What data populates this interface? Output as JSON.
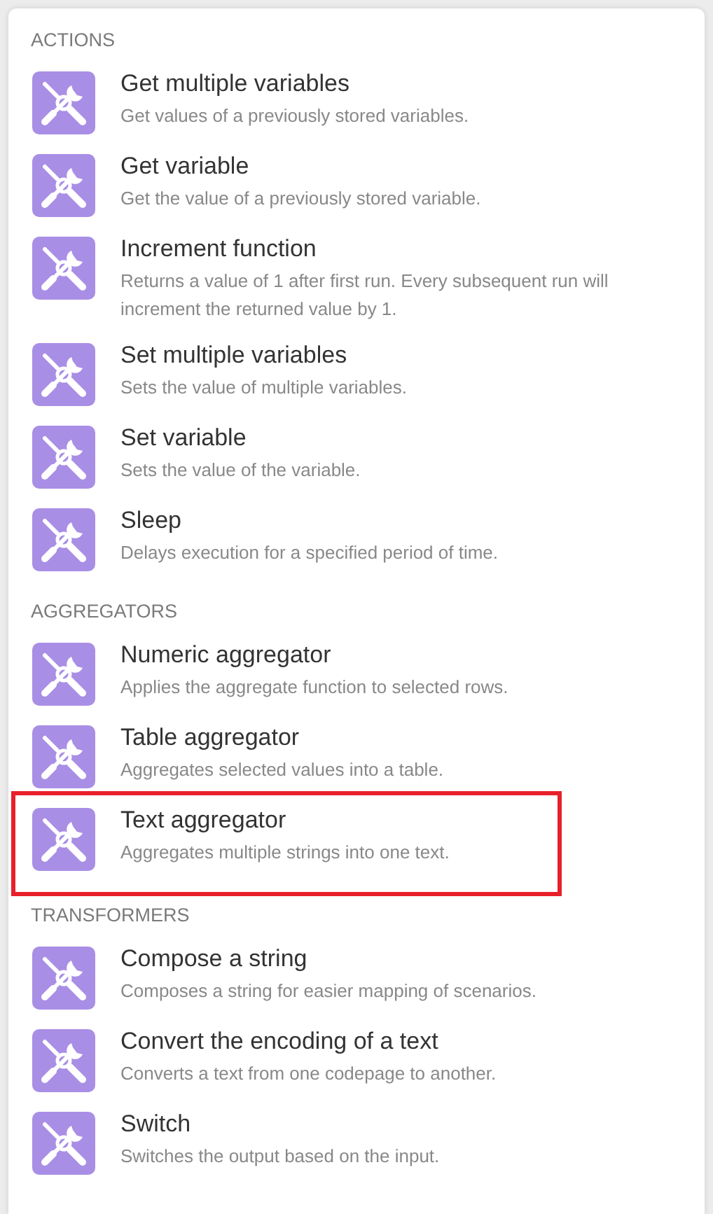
{
  "sections": [
    {
      "heading": "ACTIONS",
      "items": [
        {
          "title": "Get multiple variables",
          "description": "Get values of a previously stored variables.",
          "highlighted": false
        },
        {
          "title": "Get variable",
          "description": "Get the value of a previously stored variable.",
          "highlighted": false
        },
        {
          "title": "Increment function",
          "description": "Returns a value of 1 after first run. Every subsequent run will increment the returned value by 1.",
          "highlighted": false
        },
        {
          "title": "Set multiple variables",
          "description": "Sets the value of multiple variables.",
          "highlighted": false
        },
        {
          "title": "Set variable",
          "description": "Sets the value of the variable.",
          "highlighted": false
        },
        {
          "title": "Sleep",
          "description": "Delays execution for a specified period of time.",
          "highlighted": false
        }
      ]
    },
    {
      "heading": "AGGREGATORS",
      "items": [
        {
          "title": "Numeric aggregator",
          "description": "Applies the aggregate function to selected rows.",
          "highlighted": false
        },
        {
          "title": "Table aggregator",
          "description": "Aggregates selected values into a table.",
          "highlighted": false
        },
        {
          "title": "Text aggregator",
          "description": "Aggregates multiple strings into one text.",
          "highlighted": true
        }
      ]
    },
    {
      "heading": "TRANSFORMERS",
      "items": [
        {
          "title": "Compose a string",
          "description": "Composes a string for easier mapping of scenarios.",
          "highlighted": false
        },
        {
          "title": "Convert the encoding of a text",
          "description": "Converts a text from one codepage to another.",
          "highlighted": false
        },
        {
          "title": "Switch",
          "description": "Switches the output based on the input.",
          "highlighted": false
        }
      ]
    }
  ]
}
